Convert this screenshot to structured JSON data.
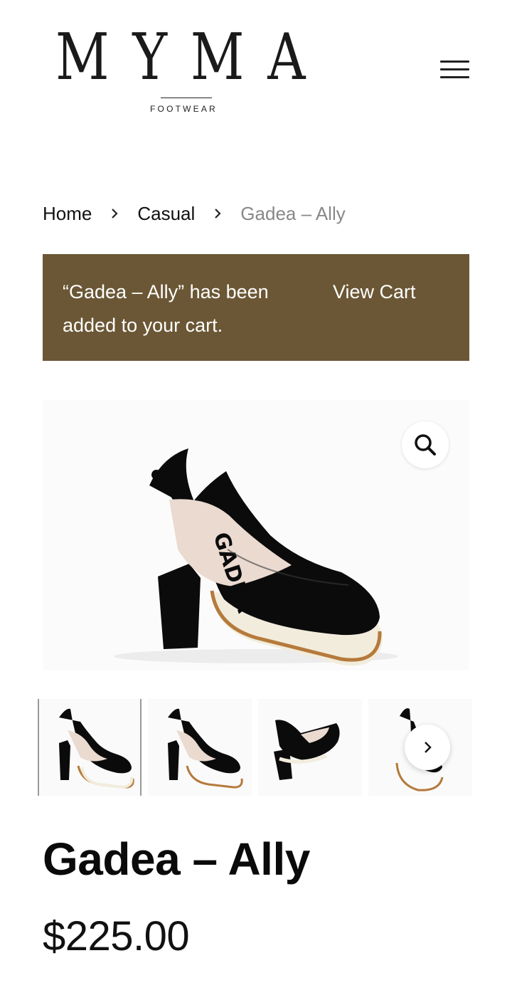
{
  "header": {
    "logo_word": "MYMA",
    "logo_sub": "FOOTWEAR",
    "menu_icon": "hamburger-menu-icon"
  },
  "breadcrumb": {
    "items": [
      "Home",
      "Casual",
      "Gadea – Ally"
    ],
    "separator_icon": "chevron-right-icon"
  },
  "notice": {
    "message": "“Gadea – Ally” has been added to your cart.",
    "link_label": "View Cart",
    "bg_color": "#6b5735"
  },
  "gallery": {
    "zoom_icon": "magnifier-icon",
    "next_icon": "chevron-right-icon",
    "thumbnail_count": 4,
    "active_thumbnail": 1
  },
  "product": {
    "title": "Gadea – Ally",
    "price": "$225.00"
  }
}
